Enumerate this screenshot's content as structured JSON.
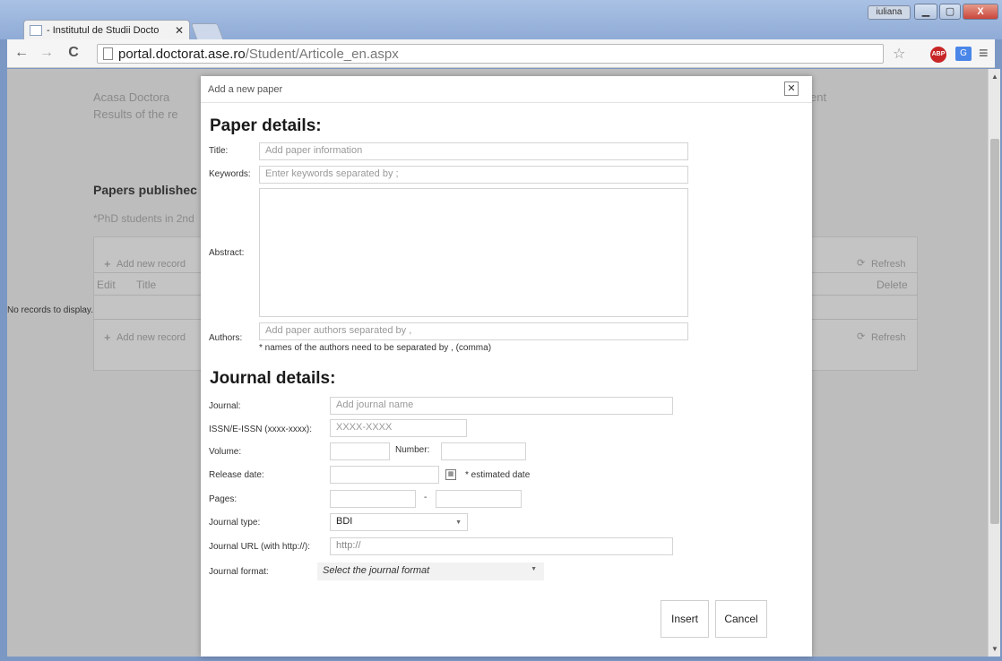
{
  "browser": {
    "tab_title": "- Institutul de Studii Docto",
    "tab_close": "✕",
    "user": "iuliana",
    "url_host": "portal.doctorat.ase.ro",
    "url_path": "/Student/Articole_en.aspx",
    "back_icon": "←",
    "forward_icon": "→",
    "reload_icon": "C",
    "star_icon": "☆",
    "abp": "ABP",
    "translate": "G",
    "menu_icon": "≡",
    "win_min": "▁",
    "win_max": "▢",
    "win_close": "X"
  },
  "background_page": {
    "nav_line1": "Acasa   Doctora",
    "nav_line1_tail": "ent",
    "nav_line2": "Results of the re",
    "papers_heading": "Papers publishec",
    "phd_note": "*PhD students in 2nd",
    "add_new_record": "Add new record",
    "refresh": "Refresh",
    "col_edit": "Edit",
    "col_title": "Title",
    "col_delete": "Delete",
    "no_records": "No records to display.",
    "plus": "+",
    "refresh_icon": "⟳"
  },
  "modal": {
    "title": "Add a new paper",
    "close": "✕",
    "paper_section": "Paper details:",
    "title_label": "Title:",
    "title_placeholder": "Add paper information",
    "keywords_label": "Keywords:",
    "keywords_placeholder": "Enter keywords separated by ;",
    "abstract_label": "Abstract:",
    "authors_label": "Authors:",
    "authors_placeholder": "Add paper authors separated by ,",
    "authors_note": "* names of the authors need to be separated by , (comma)",
    "journal_section": "Journal details:",
    "journal_label": "Journal:",
    "journal_placeholder": "Add journal name",
    "issn_label": "ISSN/E-ISSN (xxxx-xxxx):",
    "issn_placeholder": "XXXX-XXXX",
    "volume_label": "Volume:",
    "number_label": "Number:",
    "release_label": "Release date:",
    "release_note": "* estimated date",
    "pages_label": "Pages:",
    "pages_dash": "-",
    "journal_type_label": "Journal type:",
    "journal_type_value": "BDI",
    "journal_url_label": "Journal URL (with http://):",
    "journal_url_value": "http://",
    "journal_format_label": "Journal format:",
    "journal_format_value": "Select the journal format",
    "insert": "Insert",
    "cancel": "Cancel",
    "calendar_icon": "▦",
    "caret": "▼"
  }
}
